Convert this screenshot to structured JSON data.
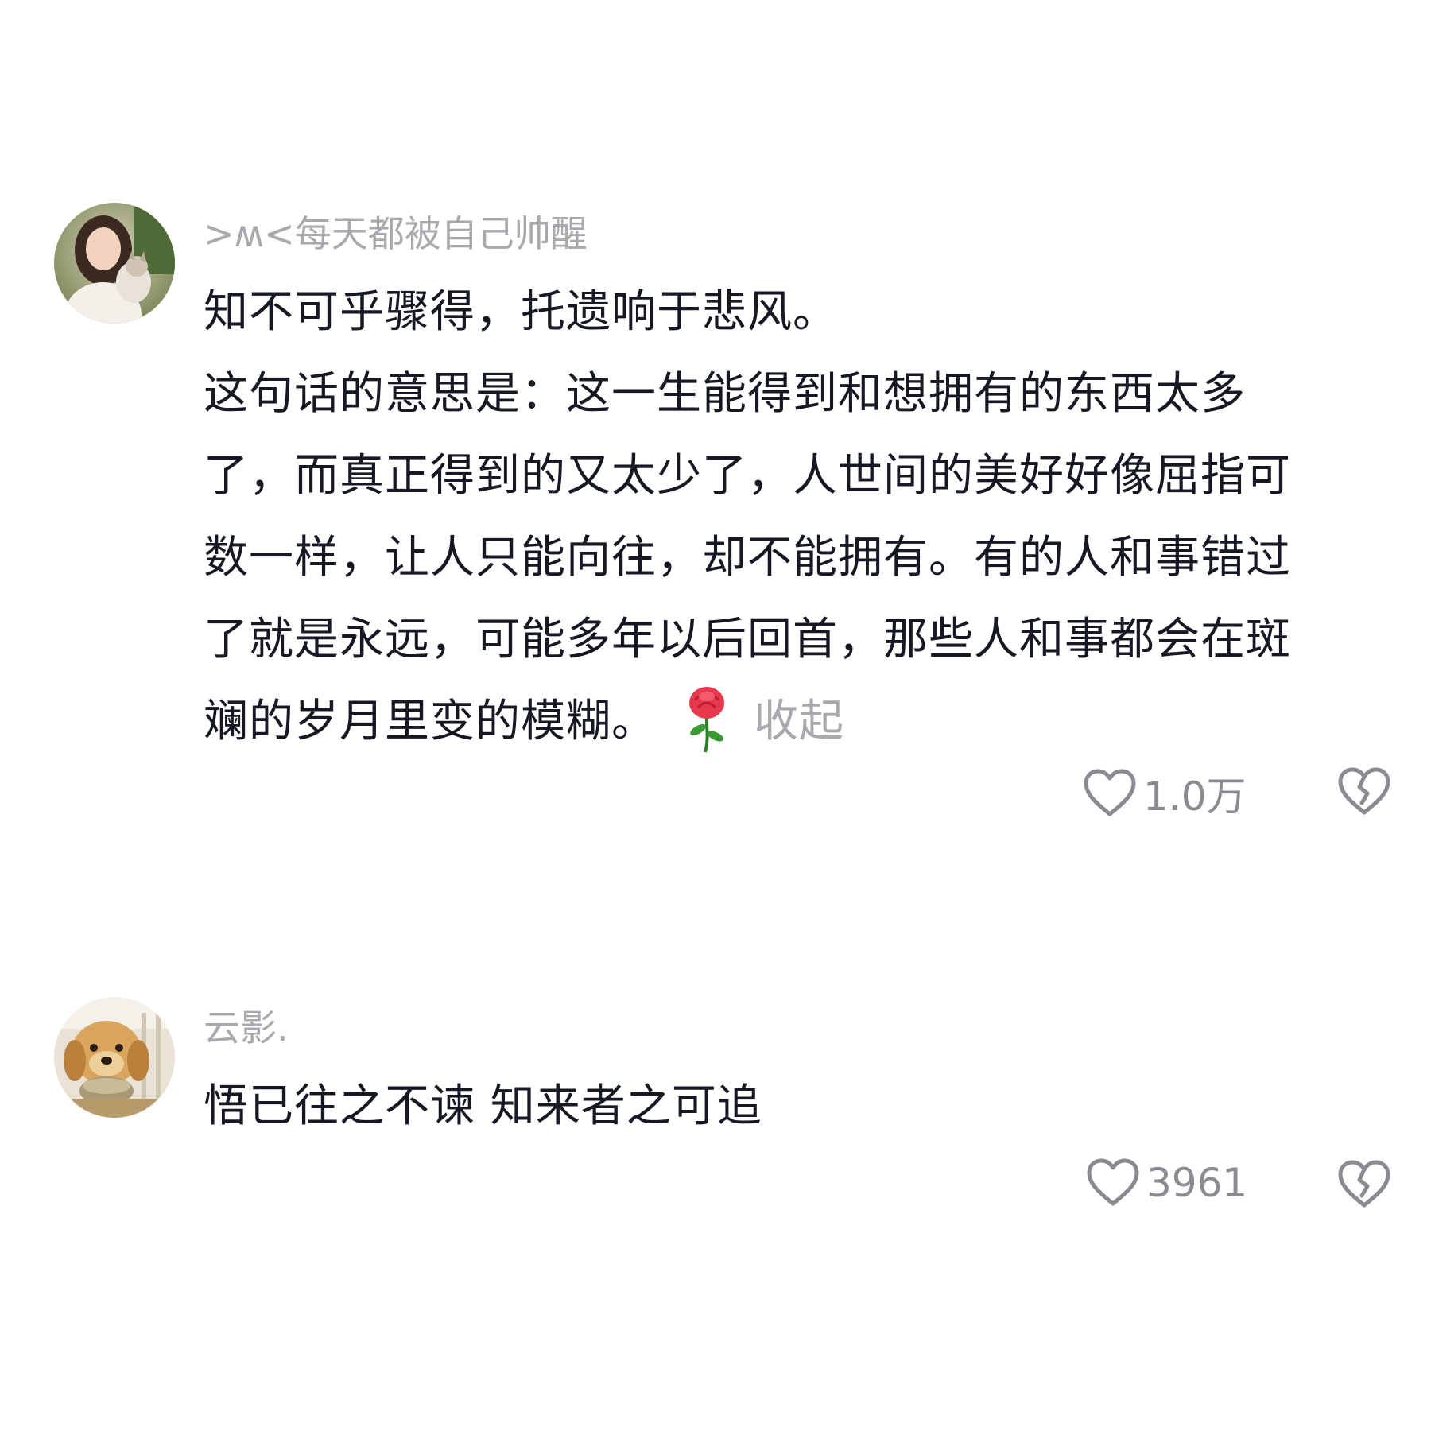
{
  "comments": [
    {
      "username": ">ʍ<每天都被自己帅醒",
      "avatar_icon": "avatar-photo-woman-with-cat",
      "lines": [
        "知不可乎骤得，托遗响于悲风。",
        "这句话的意思是：这一生能得到和想拥有的东西太多",
        "了，而真正得到的又太少了，人世间的美好好像屈指可",
        "数一样，让人只能向往，却不能拥有。有的人和事错过",
        "了就是永远，可能多年以后回首，那些人和事都会在斑"
      ],
      "last_line": "斓的岁月里变的模糊。",
      "emoji": "rose-emoji",
      "collapse_label": "收起",
      "like_icon": "heart-outline-icon",
      "like_count": "1.0万",
      "dislike_icon": "broken-heart-icon"
    },
    {
      "username": "云影.",
      "avatar_icon": "avatar-photo-golden-retriever-puppy",
      "text": "悟已往之不谏 知来者之可追",
      "like_icon": "heart-outline-icon",
      "like_count": "3961",
      "dislike_icon": "broken-heart-icon"
    }
  ],
  "colors": {
    "background": "#ffffff",
    "primary_text": "#161823",
    "secondary_text": "#a8a9ad",
    "icon_gray": "#8a8b91"
  }
}
